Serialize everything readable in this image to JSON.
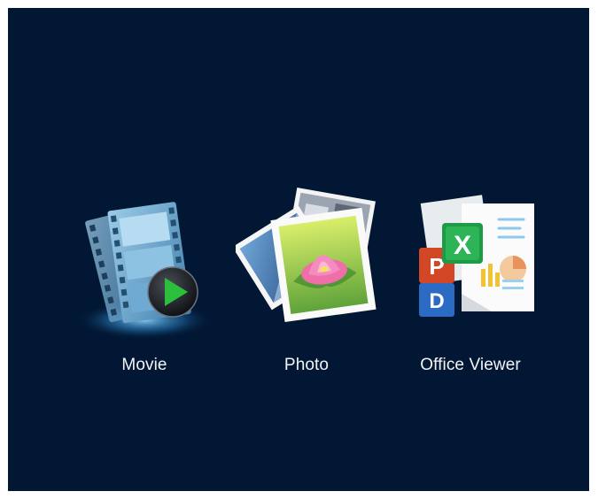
{
  "apps": [
    {
      "label": "Movie",
      "icon": "movie-film-play-icon"
    },
    {
      "label": "Photo",
      "icon": "photo-stack-icon"
    },
    {
      "label": "Office Viewer",
      "icon": "office-documents-icon"
    }
  ],
  "colors": {
    "background": "#021733",
    "label": "#f2f4f7",
    "play_button": "#2bbf3c",
    "excel": "#1f9a47",
    "powerpoint": "#d24726",
    "word": "#2b6bc4"
  }
}
